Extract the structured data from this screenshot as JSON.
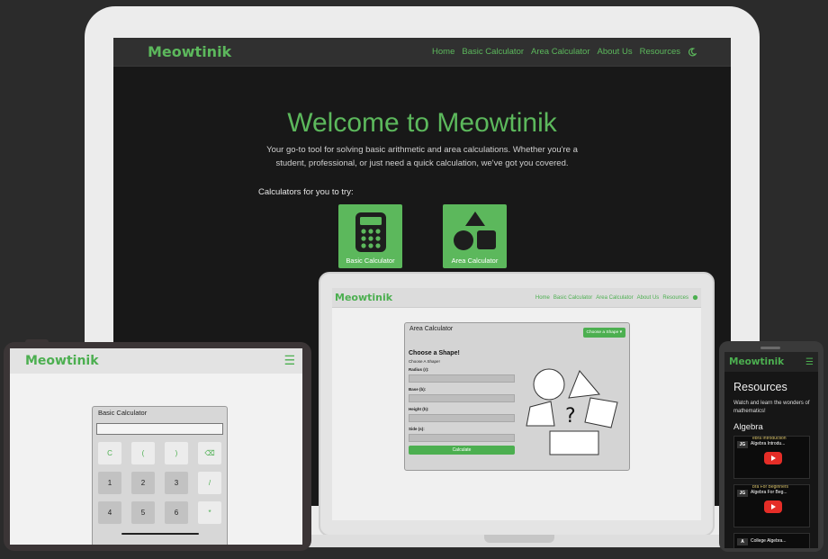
{
  "monitor": {
    "logo": "Meowtinik",
    "nav": [
      "Home",
      "Basic Calculator",
      "Area Calculator",
      "About Us",
      "Resources"
    ],
    "theme_icon": "moon-icon",
    "title": "Welcome to Meowtinik",
    "subtitle": "Your go-to tool for solving basic arithmetic and area calculations. Whether you're a student, professional, or just need a quick calculation, we've got you covered.",
    "try_label": "Calculators for you to try:",
    "cards": [
      {
        "label": "Basic Calculator",
        "icon": "calculator-icon"
      },
      {
        "label": "Area Calculator",
        "icon": "shapes-icon"
      }
    ]
  },
  "laptop": {
    "logo": "Meowtinik",
    "nav": [
      "Home",
      "Basic Calculator",
      "Area Calculator",
      "About Us",
      "Resources"
    ],
    "theme_icon": "sun-icon",
    "panel_title": "Area Calculator",
    "shape_button": "Choose a Shape",
    "heading": "Choose a Shape!",
    "subheading": "Choose A Shape!",
    "fields": [
      "Radius (r):",
      "Base (b):",
      "Height (h):",
      "Side (s):"
    ],
    "calculate": "Calculate",
    "question_mark": "?"
  },
  "tablet": {
    "logo": "Meowtinik",
    "menu_icon": "hamburger-icon",
    "calc_title": "Basic Calculator",
    "keys": [
      {
        "label": "C",
        "style": "light"
      },
      {
        "label": "(",
        "style": "light"
      },
      {
        "label": ")",
        "style": "light"
      },
      {
        "label": "⌫",
        "style": "light"
      },
      {
        "label": "1",
        "style": "dark"
      },
      {
        "label": "2",
        "style": "dark"
      },
      {
        "label": "3",
        "style": "dark"
      },
      {
        "label": "/",
        "style": "light"
      },
      {
        "label": "4",
        "style": "dark"
      },
      {
        "label": "5",
        "style": "dark"
      },
      {
        "label": "6",
        "style": "dark"
      },
      {
        "label": "*",
        "style": "light"
      }
    ]
  },
  "phone": {
    "logo": "Meowtinik",
    "menu_icon": "hamburger-icon",
    "title": "Resources",
    "description": "Watch and learn the wonders of mathematics!",
    "section": "Algebra",
    "videos": [
      {
        "badge": "JG",
        "title": "Algebra Introdu...",
        "header": "ebra Introduction"
      },
      {
        "badge": "JG",
        "title": "Algebra For Beg...",
        "header": "bra For Beginners"
      },
      {
        "badge": "A",
        "title": "College Algebra...",
        "header": ""
      }
    ]
  },
  "colors": {
    "accent": "#5cb85c",
    "dark_bg": "#181818",
    "page_bg": "#2b2b2b"
  }
}
